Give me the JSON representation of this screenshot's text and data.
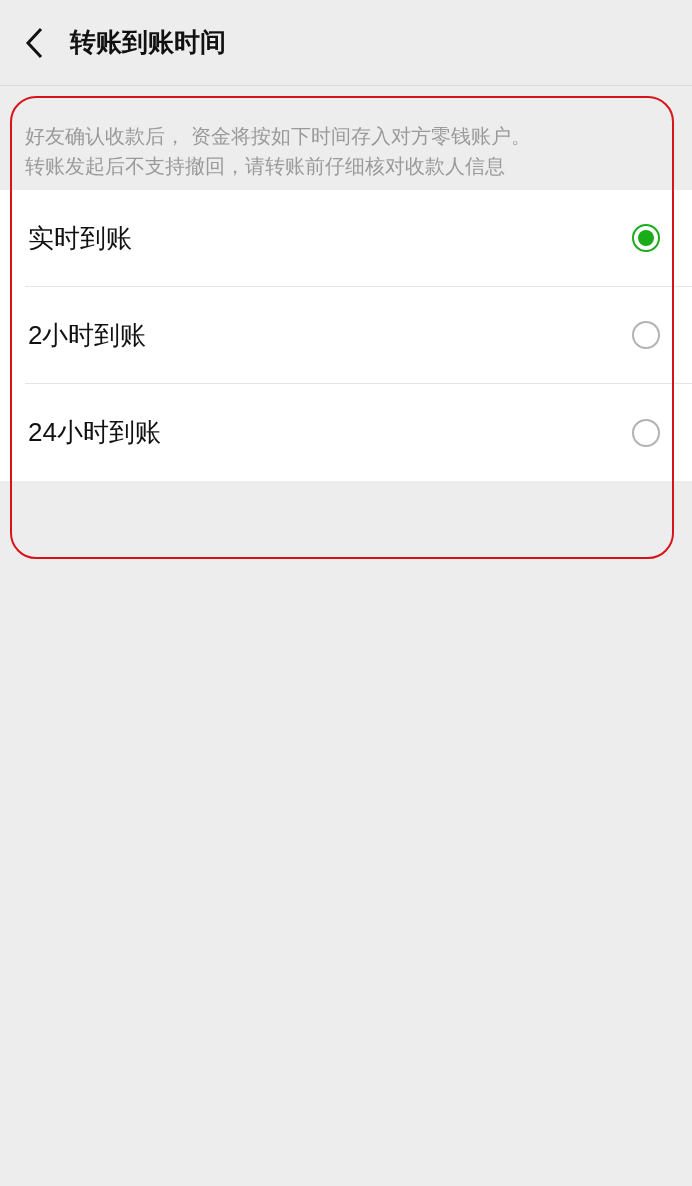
{
  "header": {
    "title": "转账到账时间"
  },
  "note": [
    "好友确认收款后， 资金将按如下时间存入对方零钱账户。",
    "转账发起后不支持撤回，请转账前仔细核对收款人信息"
  ],
  "options": [
    {
      "label": "实时到账",
      "selected": true
    },
    {
      "label": "2小时到账",
      "selected": false
    },
    {
      "label": "24小时到账",
      "selected": false
    }
  ]
}
